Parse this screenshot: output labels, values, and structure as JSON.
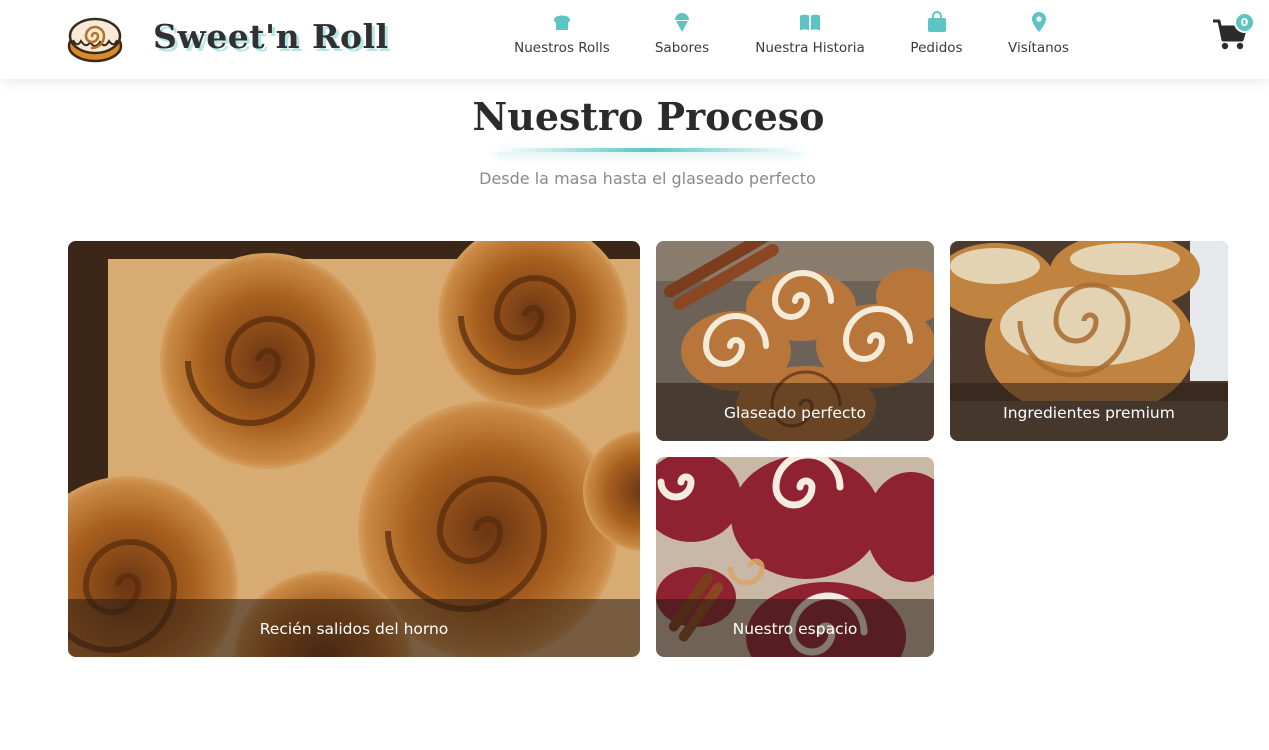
{
  "brand": {
    "name": "Sweet'n Roll",
    "logo_icon": "cinnamon-roll-icon"
  },
  "nav": {
    "items": [
      {
        "label": "Nuestros Rolls",
        "icon": "bread-icon"
      },
      {
        "label": "Sabores",
        "icon": "ice-cream-icon"
      },
      {
        "label": "Nuestra Historia",
        "icon": "book-icon"
      },
      {
        "label": "Pedidos",
        "icon": "shopping-bag-icon"
      },
      {
        "label": "Visítanos",
        "icon": "map-pin-icon"
      }
    ],
    "cart": {
      "icon": "cart-icon",
      "count": "0"
    }
  },
  "section": {
    "title": "Nuestro Proceso",
    "subtitle": "Desde la masa hasta el glaseado perfecto"
  },
  "gallery": {
    "items": [
      {
        "caption": "Recién salidos del horno"
      },
      {
        "caption": "Glaseado perfecto"
      },
      {
        "caption": "Ingredientes premium"
      },
      {
        "caption": "Nuestro espacio"
      }
    ]
  },
  "colors": {
    "accent": "#5cc4c4",
    "title": "#2b2b2b",
    "subtitle": "#8a8a8a",
    "caption_overlay": "rgba(40,28,20,0.55)"
  }
}
